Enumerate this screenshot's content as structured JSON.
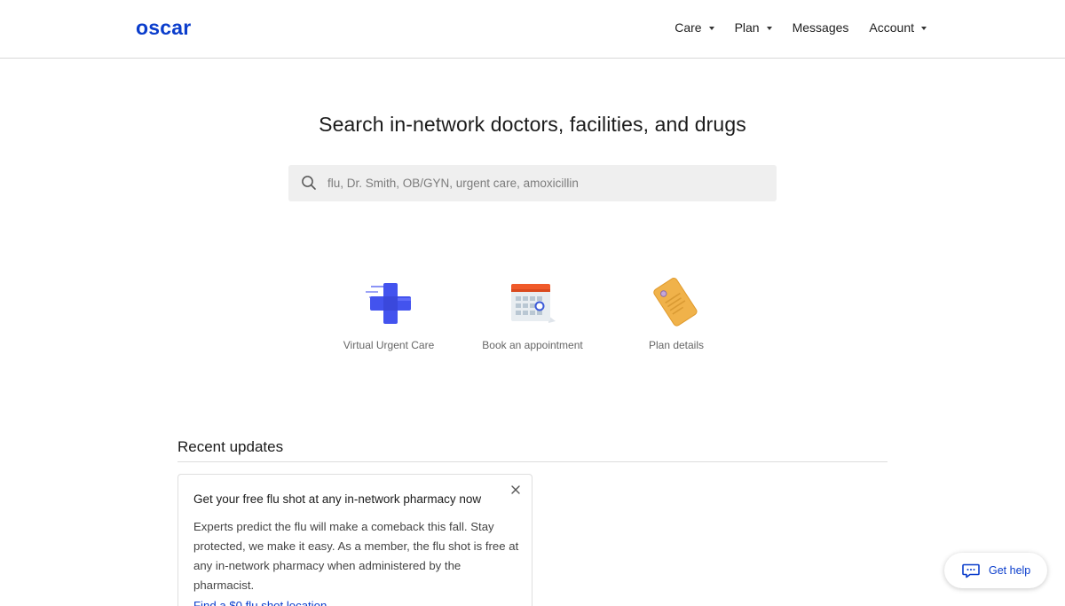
{
  "header": {
    "logo": "oscar",
    "nav": [
      {
        "label": "Care",
        "has_dropdown": true
      },
      {
        "label": "Plan",
        "has_dropdown": true
      },
      {
        "label": "Messages",
        "has_dropdown": false
      },
      {
        "label": "Account",
        "has_dropdown": true
      }
    ]
  },
  "hero": {
    "title": "Search in-network doctors, facilities, and drugs",
    "search_placeholder": "flu, Dr. Smith, OB/GYN, urgent care, amoxicillin"
  },
  "quick_actions": [
    {
      "label": "Virtual Urgent Care",
      "icon": "medical-cross-icon"
    },
    {
      "label": "Book an appointment",
      "icon": "calendar-icon"
    },
    {
      "label": "Plan details",
      "icon": "id-card-icon"
    }
  ],
  "updates": {
    "section_title": "Recent updates",
    "card": {
      "title": "Get your free flu shot at any in-network pharmacy now",
      "body": "Experts predict the flu will make a comeback this fall. Stay protected, we make it easy. As a member, the flu shot is free at any in-network pharmacy when administered by the pharmacist.",
      "link": "Find a $0 flu shot location"
    }
  },
  "help_button": {
    "label": "Get help"
  },
  "colors": {
    "brand": "#0a3dcc",
    "search_bg": "#efefef",
    "cross": "#4353ee",
    "calendar_header": "#f05a2a",
    "card_gold": "#f0b24a"
  }
}
